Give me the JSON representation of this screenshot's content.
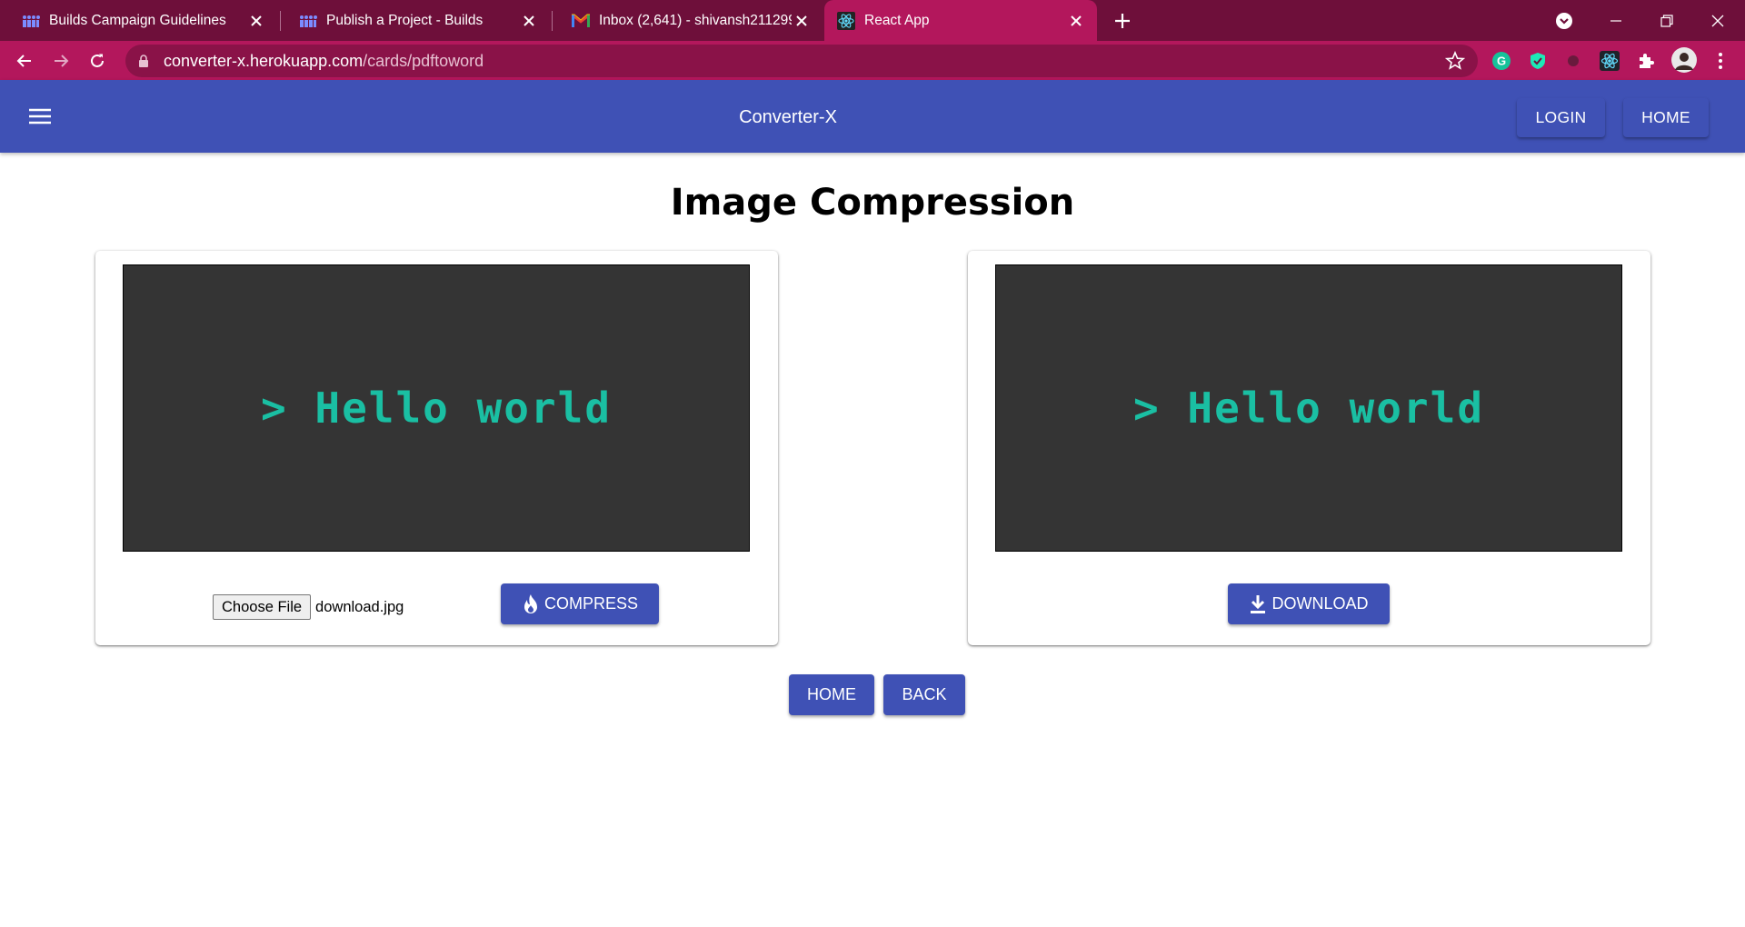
{
  "browser": {
    "tabs": [
      {
        "title": "Builds Campaign Guidelines",
        "icon": "builds-icon"
      },
      {
        "title": "Publish a Project - Builds",
        "icon": "builds-icon"
      },
      {
        "title": "Inbox (2,641) - shivansh211299@",
        "icon": "gmail-icon"
      },
      {
        "title": "React App",
        "icon": "react-icon",
        "active": true
      }
    ],
    "url_host": "converter-x.herokuapp.com",
    "url_path": "/cards/pdftoword"
  },
  "appbar": {
    "title": "Converter-X",
    "login_label": "LOGIN",
    "home_label": "HOME"
  },
  "page": {
    "title": "Image Compression"
  },
  "input_card": {
    "preview_text": "> Hello world",
    "choose_file_label": "Choose File",
    "file_name": "download.jpg",
    "compress_label": "COMPRESS"
  },
  "output_card": {
    "preview_text": "> Hello world",
    "download_label": "DOWNLOAD"
  },
  "footer_nav": {
    "home_label": "HOME",
    "back_label": "BACK"
  },
  "colors": {
    "primary": "#3f51b5",
    "tabstrip": "#6e0f3a",
    "toolbar": "#b3175c",
    "preview_bg": "#343434",
    "preview_text": "#1abfa3"
  }
}
